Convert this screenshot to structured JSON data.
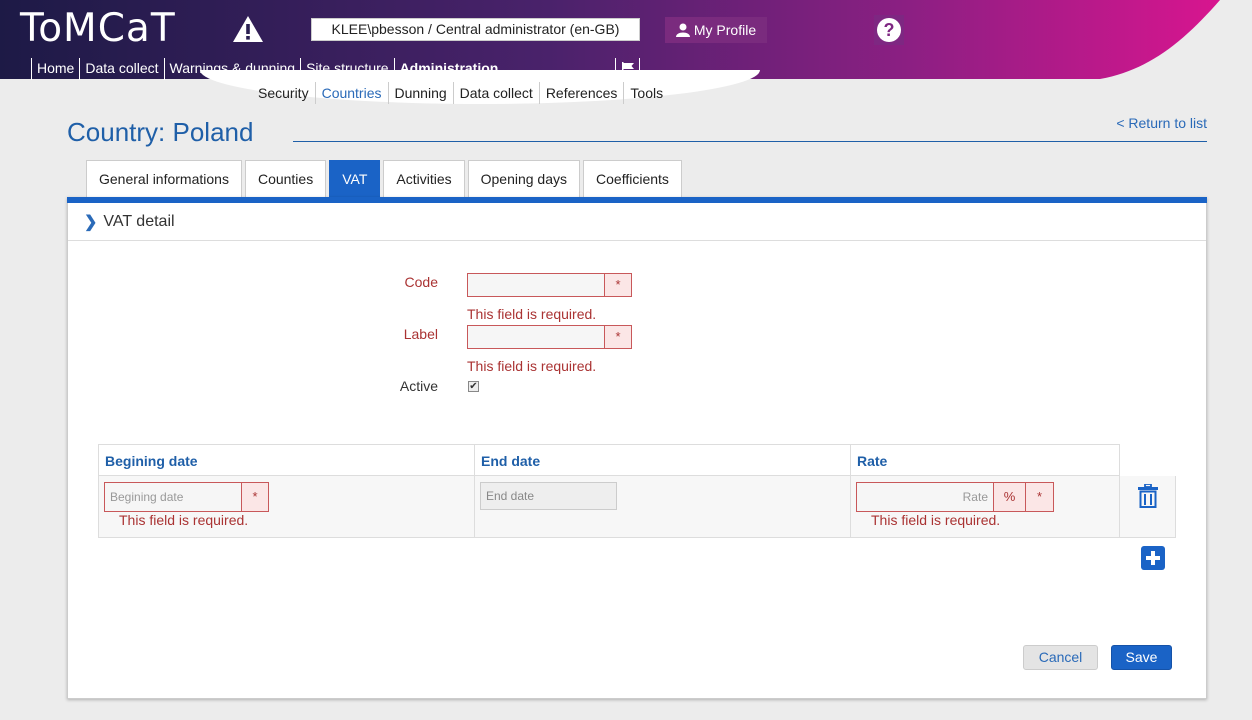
{
  "header": {
    "logo": "ToMCaT",
    "user": "KLEE\\pbesson / Central administrator (en-GB)",
    "profile_label": "My Profile",
    "help_label": "?"
  },
  "main_nav": [
    {
      "label": "Home"
    },
    {
      "label": "Data collect"
    },
    {
      "label": "Warnings & dunning"
    },
    {
      "label": "Site structure"
    },
    {
      "label": "Administration",
      "active": true
    }
  ],
  "sub_nav": [
    {
      "label": "Security"
    },
    {
      "label": "Countries",
      "active": true
    },
    {
      "label": "Dunning"
    },
    {
      "label": "Data collect"
    },
    {
      "label": "References"
    },
    {
      "label": "Tools"
    }
  ],
  "page": {
    "title": "Country: Poland",
    "return_link": "< Return to list"
  },
  "tabs": [
    {
      "label": "General informations"
    },
    {
      "label": "Counties"
    },
    {
      "label": "VAT",
      "active": true
    },
    {
      "label": "Activities"
    },
    {
      "label": "Opening days"
    },
    {
      "label": "Coefficients"
    }
  ],
  "panel": {
    "title": "VAT detail",
    "fields": {
      "code_label": "Code",
      "code_value": "",
      "code_required": "*",
      "code_error": "This field is required.",
      "label_label": "Label",
      "label_value": "",
      "label_required": "*",
      "label_error": "This field is required.",
      "active_label": "Active",
      "active_checked": true
    },
    "table": {
      "headers": [
        "Begining date",
        "End date",
        "Rate"
      ],
      "row": {
        "begin_placeholder": "Begining date",
        "begin_required": "*",
        "begin_error": "This field is required.",
        "end_placeholder": "End date",
        "rate_placeholder": "Rate",
        "rate_unit": "%",
        "rate_required": "*",
        "rate_error": "This field is required."
      }
    },
    "buttons": {
      "cancel": "Cancel",
      "save": "Save"
    }
  },
  "colors": {
    "accent": "#1a63c6",
    "header_dark": "#1d1d4a",
    "header_magenta": "#d0168f",
    "error": "#aa3333"
  }
}
